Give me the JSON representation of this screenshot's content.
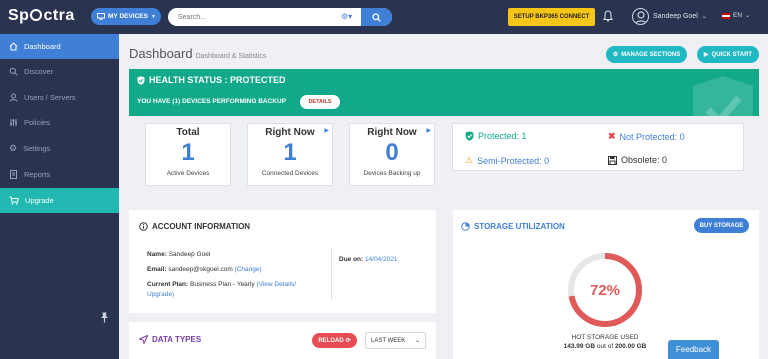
{
  "topbar": {
    "logo_left": "Sp",
    "logo_right": "ctra",
    "devices_label": "MY DEVICES",
    "search_placeholder": "Search...",
    "setup_label": "SETUP BKP365 CONNECT",
    "user_name": "Sandeep Goel",
    "language": "EN"
  },
  "sidebar": {
    "items": [
      {
        "label": "Dashboard",
        "icon": "home-icon"
      },
      {
        "label": "Discover",
        "icon": "search-icon"
      },
      {
        "label": "Users / Servers",
        "icon": "users-icon"
      },
      {
        "label": "Policies",
        "icon": "sliders-icon"
      },
      {
        "label": "Settings",
        "icon": "gear-icon"
      },
      {
        "label": "Reports",
        "icon": "reports-icon"
      },
      {
        "label": "Upgrade",
        "icon": "cart-icon"
      }
    ]
  },
  "header": {
    "title": "Dashboard",
    "subtitle": "Dashboard & Statistics",
    "manage_label": "MANAGE SECTIONS",
    "quick_label": "QUICK START"
  },
  "health": {
    "title": "HEALTH STATUS : PROTECTED",
    "message": "YOU HAVE (1) DEVICES PERFORMING BACKUP",
    "details_label": "DETAILS"
  },
  "stats": [
    {
      "heading": "Total",
      "value": "1",
      "label": "Active Devices"
    },
    {
      "heading": "Right Now",
      "value": "1",
      "label": "Connected Devices"
    },
    {
      "heading": "Right Now",
      "value": "0",
      "label": "Devices Backing up"
    }
  ],
  "status": {
    "protected": "Protected: 1",
    "not_protected": "Not Protected: 0",
    "semi_protected": "Semi-Protected: 0",
    "obsolete": "Obsolete: 0",
    "colors": {
      "protected": "#12a98a",
      "not_protected": "#e0464f",
      "semi_protected": "#f0a020",
      "obsolete": "#333333"
    }
  },
  "account": {
    "title": "ACCOUNT INFORMATION",
    "name_label": "Name:",
    "name_value": "Sandeep Goel",
    "email_label": "Email:",
    "email_value": "sandeep@skgoel.com",
    "change_link": "(Change)",
    "plan_label": "Current Plan:",
    "plan_value": "Business Plan - Yearly",
    "plan_link_1": "(View Details/",
    "plan_link_2": "Upgrade)",
    "due_label": "Due on:",
    "due_value": "14/04/2021"
  },
  "storage": {
    "title": "STORAGE UTILIZATION",
    "buy_label": "BUY STORAGE",
    "percent_text": "72%",
    "percent": 72,
    "used_label": "HOT STORAGE USED",
    "used_value": "143.99 GB",
    "out_of": "out of",
    "total_value": "200.00 GB"
  },
  "data_types": {
    "title": "DATA TYPES",
    "reload_label": "RELOAD",
    "range_value": "LAST WEEK"
  },
  "feedback_label": "Feedback"
}
